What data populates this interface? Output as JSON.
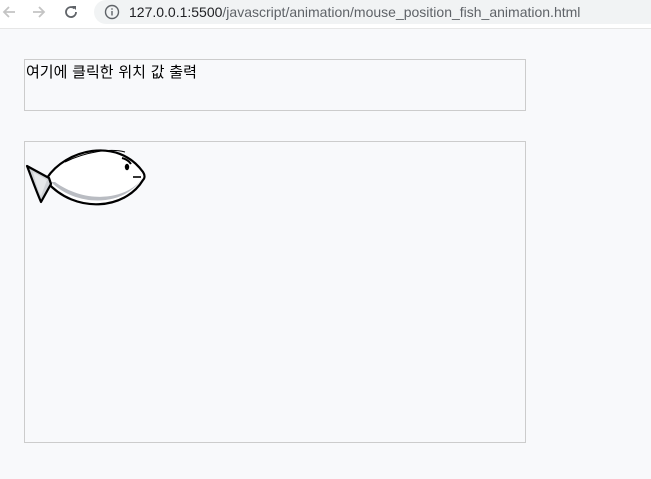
{
  "browser": {
    "url_host": "127.0.0.1:5500",
    "url_path": "/javascript/animation/mouse_position_fish_animation.html",
    "icons": [
      "back-arrow-icon",
      "forward-arrow-icon",
      "reload-icon",
      "info-icon"
    ]
  },
  "page": {
    "output_text": "여기에 클릭한 위치 값 출력",
    "fish": "fish-image"
  },
  "colors": {
    "background": "#f8f9fb",
    "border": "#cccccc",
    "url_bar": "#f1f3f4"
  }
}
